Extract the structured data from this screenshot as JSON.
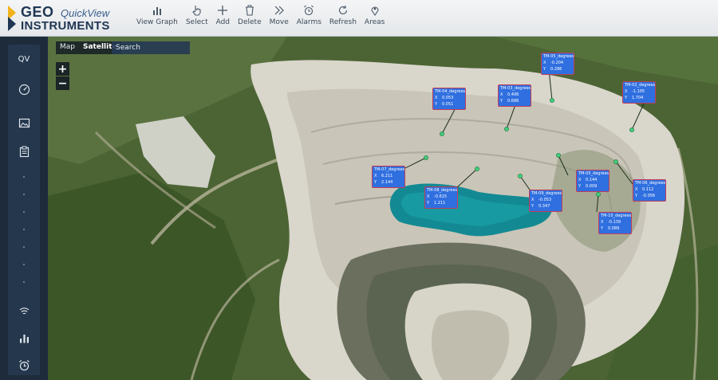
{
  "app": {
    "logo_geo": "GEO",
    "logo_product": "QuickView",
    "logo_instruments": "INSTRUMENTS"
  },
  "toolbar": {
    "items": [
      {
        "label": "View Graph",
        "icon": "bar-chart-icon"
      },
      {
        "label": "Select",
        "icon": "pointer-hand-icon"
      },
      {
        "label": "Add",
        "icon": "plus-icon"
      },
      {
        "label": "Delete",
        "icon": "trash-icon"
      },
      {
        "label": "Move",
        "icon": "double-chevron-right-icon"
      },
      {
        "label": "Alarms",
        "icon": "alarm-clock-icon"
      },
      {
        "label": "Refresh",
        "icon": "refresh-icon"
      },
      {
        "label": "Areas",
        "icon": "map-pin-icon"
      }
    ]
  },
  "sidebar": {
    "qv_label": "QV",
    "icons": [
      "dashboard-gauge-icon",
      "image-icon",
      "clipboard-icon",
      "wifi-icon",
      "bar-chart-icon",
      "alarm-clock-icon"
    ]
  },
  "map": {
    "type_map_label": "Map",
    "type_satellite_label": "Satellite",
    "selected_type": "Satellite",
    "search_placeholder": "Search",
    "zoom_in_label": "+",
    "zoom_out_label": "−"
  },
  "sensors": [
    {
      "name": "TM-05_degrees",
      "x_label": "X",
      "x_value": "-0.204",
      "y_label": "Y",
      "y_value": "0.286"
    },
    {
      "name": "TM-04_degrees",
      "x_label": "X",
      "x_value": "0.053",
      "y_label": "Y",
      "y_value": "0.051"
    },
    {
      "name": "TM-03_degrees",
      "x_label": "X",
      "x_value": "0.406",
      "y_label": "Y",
      "y_value": "0.686"
    },
    {
      "name": "TM-02_degrees",
      "x_label": "X",
      "x_value": "-1.105",
      "y_label": "Y",
      "y_value": "1.704"
    },
    {
      "name": "TM-07_degrees",
      "x_label": "X",
      "x_value": "6.211",
      "y_label": "Y",
      "y_value": "2.144"
    },
    {
      "name": "TM-05_degrees",
      "x_label": "X",
      "x_value": "0.144",
      "y_label": "Y",
      "y_value": "0.009"
    },
    {
      "name": "TM-06_degrees",
      "x_label": "X",
      "x_value": "0.112",
      "y_label": "Y",
      "y_value": "-0.056"
    },
    {
      "name": "TM-08_degrees",
      "x_label": "X",
      "x_value": "-0.615",
      "y_label": "Y",
      "y_value": "1.211"
    },
    {
      "name": "TM-09_degrees",
      "x_label": "X",
      "x_value": "-0.053",
      "y_label": "Y",
      "y_value": "0.347"
    },
    {
      "name": "TM-10_degrees",
      "x_label": "X",
      "x_value": "-0.139",
      "y_label": "Y",
      "y_value": "0.089"
    }
  ],
  "colors": {
    "sensor_box": "#2f6fe0",
    "sensor_border": "#c23d56",
    "sensor_marker": "#3fd07a",
    "sidebar": "#1d2b3b",
    "header_text": "#1f3653"
  }
}
